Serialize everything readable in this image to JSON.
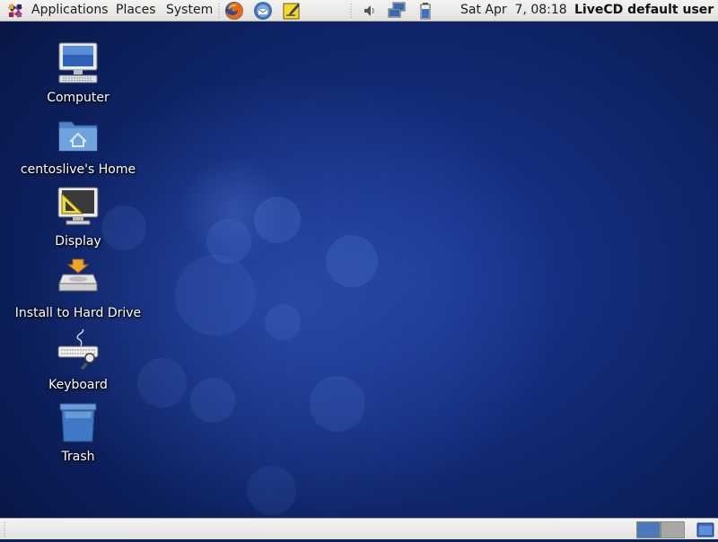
{
  "top_panel": {
    "menus": [
      "Applications",
      "Places",
      "System"
    ],
    "launchers": [
      "firefox-icon",
      "mail-client-icon",
      "notes-icon"
    ],
    "tray": [
      "volume-icon",
      "network-icon",
      "battery-icon"
    ],
    "clock": "Sat Apr  7, 08:18",
    "user": "LiveCD default user"
  },
  "desktop": {
    "icons": [
      {
        "label": "Computer",
        "icon": "computer-icon"
      },
      {
        "label": "centoslive's Home",
        "icon": "home-folder-icon"
      },
      {
        "label": "Display",
        "icon": "display-icon"
      },
      {
        "label": "Install to Hard Drive",
        "icon": "install-drive-icon"
      },
      {
        "label": "Keyboard",
        "icon": "keyboard-icon"
      },
      {
        "label": "Trash",
        "icon": "trash-icon"
      }
    ]
  },
  "bottom_panel": {
    "workspaces": 2,
    "active_workspace": 1
  },
  "colors": {
    "panel": "#e8e7e4",
    "desktop": "#13307f",
    "workspace_active": "#4e79b8",
    "workspace_inactive": "#a9a8a4"
  }
}
